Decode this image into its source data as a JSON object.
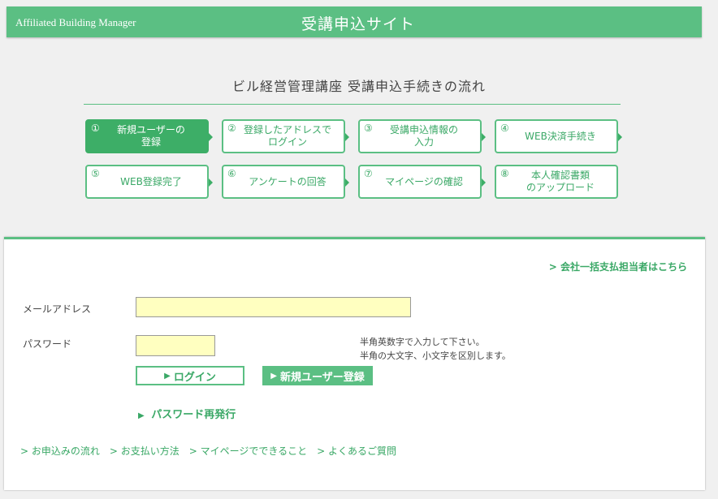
{
  "header": {
    "brand": "Affiliated Building Manager",
    "title": "受講申込サイト"
  },
  "flow": {
    "title": "ビル経営管理講座 受講申込手続きの流れ",
    "steps": [
      {
        "num": "①",
        "label": "新規ユーザーの\n登録",
        "active": true
      },
      {
        "num": "②",
        "label": "登録したアドレスで\nログイン"
      },
      {
        "num": "③",
        "label": "受講申込情報の\n入力"
      },
      {
        "num": "④",
        "label": "WEB決済手続き"
      },
      {
        "num": "⑤",
        "label": "WEB登録完了"
      },
      {
        "num": "⑥",
        "label": "アンケートの回答"
      },
      {
        "num": "⑦",
        "label": "マイページの確認"
      },
      {
        "num": "⑧",
        "label": "本人確認書類\nのアップロード"
      }
    ]
  },
  "login": {
    "corporate_link": "> 会社一括支払担当者はこちら",
    "email_label": "メールアドレス",
    "email_value": "",
    "password_label": "パスワード",
    "password_value": "",
    "hint_line1": "半角英数字で入力して下さい。",
    "hint_line2": "半角の大文字、小文字を区別します。",
    "login_button": "ログイン",
    "register_button": "新規ユーザー登録",
    "reissue_link": "パスワード再発行",
    "arrow_icon": "▶"
  },
  "footer": {
    "links": [
      "> お申込みの流れ",
      "> お支払い方法",
      "> マイページでできること",
      "> よくあるご質問"
    ]
  },
  "colors": {
    "accent": "#5bbf83",
    "accent_dark": "#3dae67",
    "input_bg": "#ffffc0"
  }
}
